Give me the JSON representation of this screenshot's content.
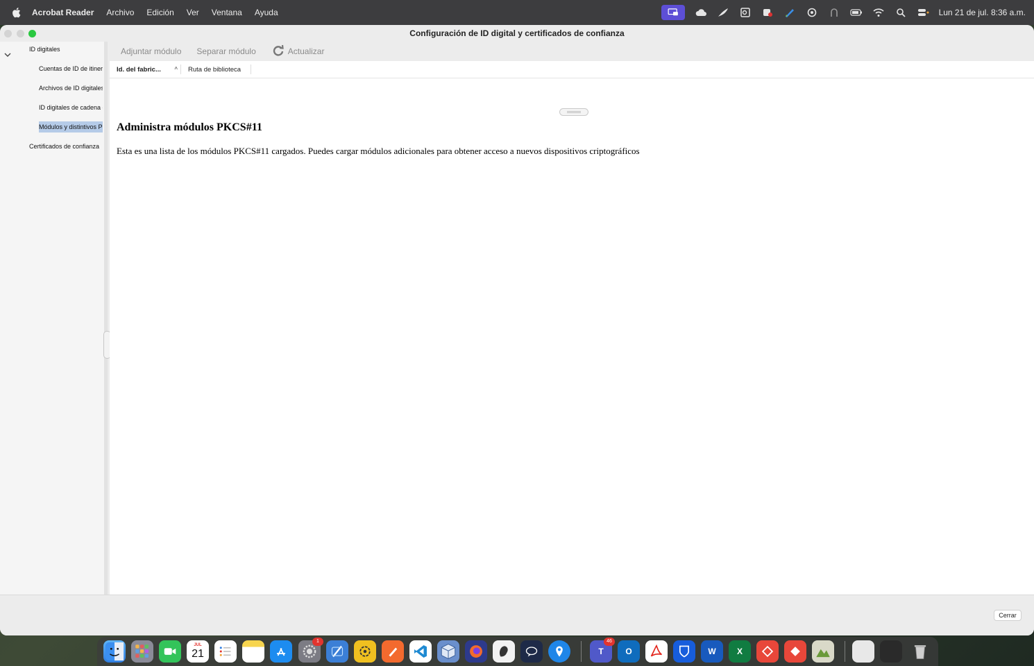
{
  "menubar": {
    "app_name": "Acrobat Reader",
    "items": [
      "Archivo",
      "Edición",
      "Ver",
      "Ventana",
      "Ayuda"
    ],
    "clock": "Lun 21 de jul.  8:36 a.m.",
    "status_icons": [
      "screen-mirroring-icon",
      "cloud-icon",
      "feather-icon",
      "outlook-status-icon",
      "office-status-icon",
      "pen-icon",
      "creative-cloud-icon",
      "vpn-icon",
      "battery-icon",
      "wifi-icon",
      "search-icon",
      "control-center-icon"
    ]
  },
  "window": {
    "title": "Configuración de ID digital y certificados de confianza"
  },
  "sidebar": {
    "root": "ID digitales",
    "items": [
      "Cuentas de ID de itinera",
      "Archivos de ID digitales",
      "ID digitales de cadena c",
      "Módulos y distintivos P"
    ],
    "selected_index": 3,
    "trust": "Certificados de confianza"
  },
  "toolbar": {
    "attach": "Adjuntar módulo",
    "detach": "Separar módulo",
    "refresh": "Actualizar"
  },
  "columns": {
    "manufacturer": "Id. del fabric...",
    "library_path": "Ruta de biblioteca"
  },
  "info": {
    "title": "Administra módulos PKCS#11",
    "description": "Esta es una lista de los módulos PKCS#11 cargados. Puedes cargar módulos adicionales para obtener acceso a nuevos dispositivos criptográficos"
  },
  "footer": {
    "close": "Cerrar"
  },
  "dock": {
    "calendar_month": "JUL",
    "calendar_day": "21",
    "badges": {
      "system-settings": "1",
      "teams": "46"
    }
  },
  "colors": {
    "menubar": "#3d3d3f",
    "selection": "#b5cbe8",
    "screen_mirror_accent": "#5d4fd6",
    "zoom_button": "#2ac840"
  }
}
